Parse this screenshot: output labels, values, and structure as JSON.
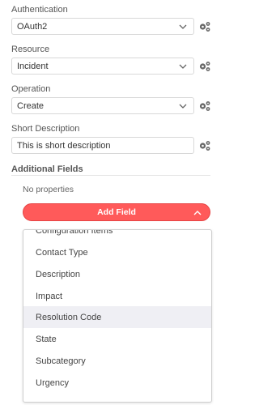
{
  "authentication": {
    "label": "Authentication",
    "value": "OAuth2"
  },
  "resource": {
    "label": "Resource",
    "value": "Incident"
  },
  "operation": {
    "label": "Operation",
    "value": "Create"
  },
  "short_description": {
    "label": "Short Description",
    "value": "This is short description"
  },
  "additional_fields": {
    "label": "Additional Fields",
    "empty_text": "No properties",
    "add_button_label": "Add Field"
  },
  "dropdown": {
    "partial_top_item": "Configuration Items",
    "items": [
      "Contact Type",
      "Description",
      "Impact",
      "Resolution Code",
      "State",
      "Subcategory",
      "Urgency"
    ],
    "highlighted": "Resolution Code"
  },
  "colors": {
    "accent": "#ff5a5a",
    "hover": "#efeff4",
    "border": "#d8d8d8"
  },
  "icons": {
    "parameter_options": "gears-icon",
    "select_arrow": "chevron-down-icon",
    "collapse": "chevron-up-icon"
  }
}
